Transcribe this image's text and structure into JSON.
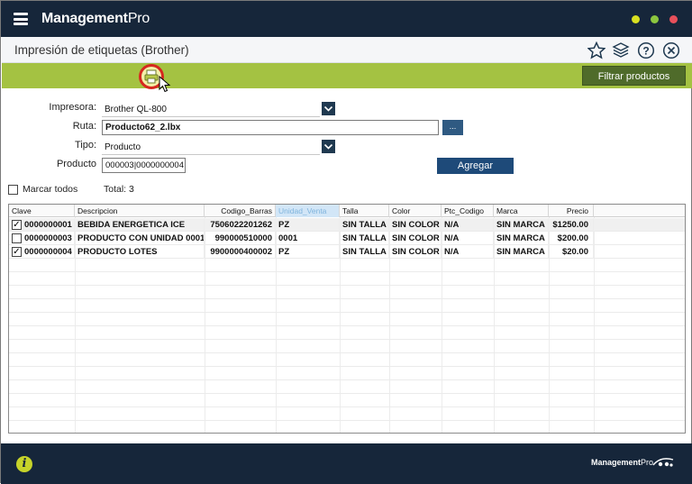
{
  "app": {
    "brand_bold": "Management",
    "brand_light": "Pro"
  },
  "window_buttons": {
    "minimize_color": "#d9e021",
    "maximize_color": "#8cc63f",
    "close_color": "#e8505b"
  },
  "header": {
    "title": "Impresión de etiquetas (Brother)"
  },
  "toolbar": {
    "filter_label": "Filtrar productos",
    "accent": "#a4c242"
  },
  "form": {
    "impresora_label": "Impresora:",
    "impresora_value": "Brother QL-800",
    "ruta_label": "Ruta:",
    "ruta_value": "Producto62_2.lbx",
    "browse_label": "...",
    "tipo_label": "Tipo:",
    "tipo_value": "Producto",
    "producto_label": "Producto",
    "producto_value": "000003|0000000004",
    "agregar_label": "Agregar",
    "marcar_todos_label": "Marcar todos",
    "total_label": "Total: 3"
  },
  "grid": {
    "columns": [
      "Clave",
      "Descripcion",
      "Codigo_Barras",
      "Unidad_Venta",
      "Talla",
      "Color",
      "Ptc_Codigo",
      "Marca",
      "Precio"
    ],
    "rows": [
      {
        "checked": true,
        "clave": "0000000001",
        "descripcion": "BEBIDA ENERGETICA ICE",
        "codigo_barras": "7506022201262",
        "unidad_venta": "PZ",
        "talla": "SIN TALLA",
        "color": "SIN COLOR",
        "ptc_codigo": "N/A",
        "marca": "SIN MARCA",
        "precio": "$1250.00"
      },
      {
        "checked": false,
        "clave": "0000000003",
        "descripcion": "PRODUCTO CON UNIDAD 0001",
        "codigo_barras": "990000510000",
        "unidad_venta": "0001",
        "talla": "SIN TALLA",
        "color": "SIN COLOR",
        "ptc_codigo": "N/A",
        "marca": "SIN MARCA",
        "precio": "$200.00"
      },
      {
        "checked": true,
        "clave": "0000000004",
        "descripcion": "PRODUCTO LOTES",
        "codigo_barras": "9900000400002",
        "unidad_venta": "PZ",
        "talla": "SIN TALLA",
        "color": "SIN COLOR",
        "ptc_codigo": "N/A",
        "marca": "SIN MARCA",
        "precio": "$20.00"
      }
    ]
  },
  "footer": {
    "info_glyph": "i",
    "brand_bold": "Management",
    "brand_light": "Pro"
  },
  "icons": [
    "menu-icon",
    "star-icon",
    "layers-icon",
    "help-icon",
    "close-icon",
    "printer-icon",
    "chevron-down-icon",
    "info-icon"
  ]
}
